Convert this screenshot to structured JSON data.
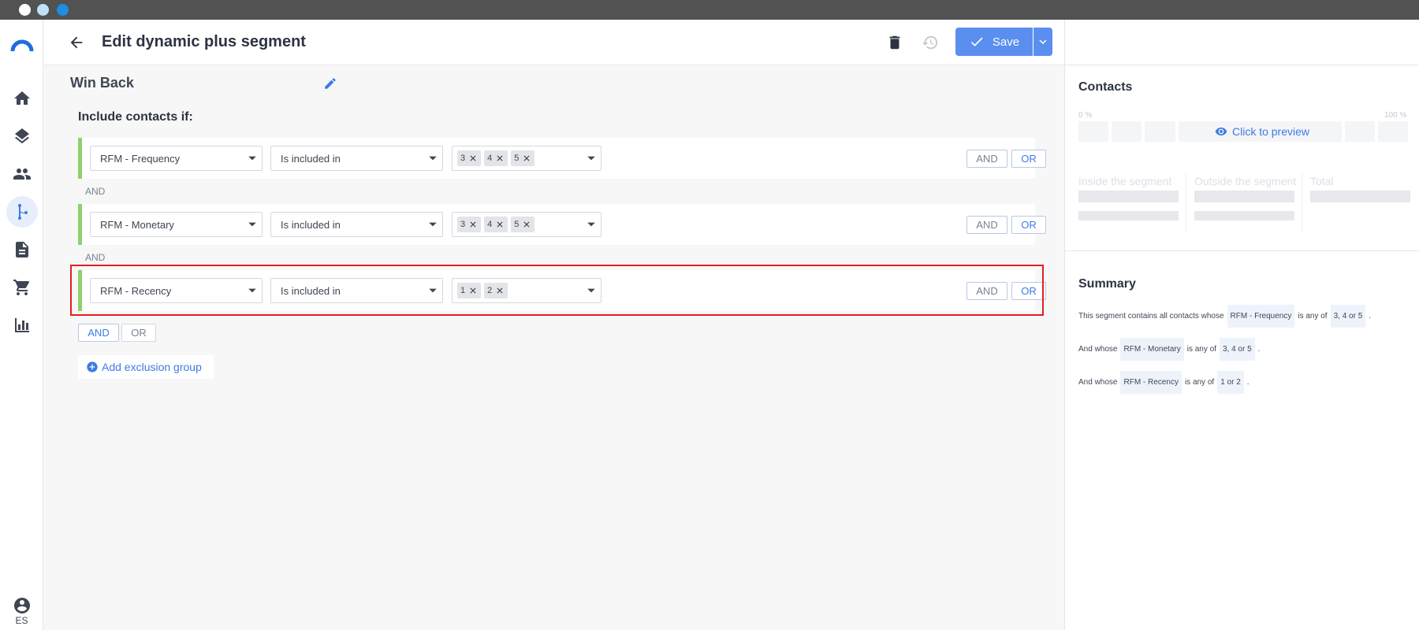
{
  "window": {
    "dots": [
      "close",
      "minimize",
      "maximize"
    ]
  },
  "nav": {
    "items": [
      {
        "name": "logo-icon"
      },
      {
        "name": "home-icon"
      },
      {
        "name": "layers-icon"
      },
      {
        "name": "contacts-icon"
      },
      {
        "name": "segments-icon",
        "active": true
      },
      {
        "name": "document-icon"
      },
      {
        "name": "cart-icon"
      },
      {
        "name": "analytics-icon"
      }
    ],
    "language": "ES"
  },
  "header": {
    "title": "Edit dynamic plus segment",
    "save_label": "Save"
  },
  "segment": {
    "name": "Win Back",
    "include_label": "Include contacts if:",
    "conditions": [
      {
        "field": "RFM - Frequency",
        "operator": "Is included in",
        "values": [
          "3",
          "4",
          "5"
        ]
      },
      {
        "field": "RFM - Monetary",
        "operator": "Is included in",
        "values": [
          "3",
          "4",
          "5"
        ]
      },
      {
        "field": "RFM - Recency",
        "operator": "Is included in",
        "values": [
          "1",
          "2"
        ]
      }
    ],
    "separator": "AND",
    "and_label": "AND",
    "or_label": "OR",
    "add_exclusion": "Add exclusion group"
  },
  "contacts": {
    "title": "Contacts",
    "pct_min": "0 %",
    "pct_max": "100 %",
    "preview_label": "Click to preview",
    "inside_label": "Inside the segment",
    "outside_label": "Outside the segment",
    "total_label": "Total"
  },
  "summary": {
    "title": "Summary",
    "line1_prefix": "This segment contains all contacts whose",
    "line_prefix": "And whose",
    "is_any_of": "is any of",
    "period": ".",
    "lines": [
      {
        "field": "RFM - Frequency",
        "values": "3, 4 or 5"
      },
      {
        "field": "RFM - Monetary",
        "values": "3, 4 or 5"
      },
      {
        "field": "RFM - Recency",
        "values": "1 or 2"
      }
    ]
  },
  "colors": {
    "accent": "#5a8ff0",
    "condition_bar": "#8fd06a",
    "highlight": "#e02020"
  }
}
